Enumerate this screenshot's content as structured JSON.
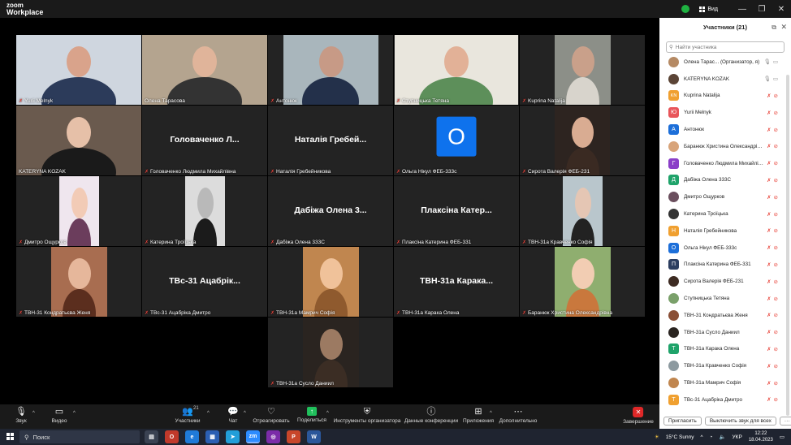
{
  "titlebar": {
    "logo_line1": "zoom",
    "logo_line2": "Workplace",
    "view_label": "Вид",
    "minimize": "—",
    "restore": "❐",
    "close": "✕",
    "colors": {
      "shield": "#1fb141"
    }
  },
  "tiles": [
    {
      "name": "Yurii Melnyk",
      "kind": "video",
      "muted": true,
      "colors": {
        "bg": "#cfd6df",
        "skin": "#d9a38b",
        "cloth": "#2c3b5a"
      }
    },
    {
      "name": "Олена Тарасова",
      "kind": "video",
      "muted": false,
      "colors": {
        "bg": "#b4a48f",
        "skin": "#e0b49a",
        "cloth": "#333333"
      }
    },
    {
      "name": "Антонюк",
      "kind": "video",
      "muted": true,
      "colors": {
        "bg": "#a9b6bc",
        "skin": "#c79a86",
        "cloth": "#23304a"
      }
    },
    {
      "name": "Ступницька Тетяна",
      "kind": "video",
      "muted": true,
      "colors": {
        "bg": "#e9e6dd",
        "skin": "#e2b197",
        "cloth": "#5d8f5a"
      }
    },
    {
      "name": "Kuprina Natalija",
      "kind": "video",
      "muted": true,
      "colors": {
        "bg": "#8c8f88",
        "skin": "#c9a08a",
        "cloth": "#d8d4cc"
      }
    },
    {
      "name": "KATERYNA KOZAK",
      "kind": "video",
      "muted": false,
      "active": true,
      "colors": {
        "bg": "#6a5a4e",
        "skin": "#e6c0a8",
        "cloth": "#1a1a1a"
      }
    },
    {
      "name": "Головаченко Людмила Михайлівна",
      "kind": "text",
      "display": "Головаченко Л...",
      "muted": true
    },
    {
      "name": "Наталія Гребейникова",
      "kind": "text",
      "display": "Наталія Гребей...",
      "muted": true
    },
    {
      "name": "Ольга Нікул ФЕБ-333с",
      "kind": "avatar",
      "letter": "О",
      "muted": true,
      "colors": {
        "avatar": "#0e72ed"
      }
    },
    {
      "name": "Сирота Валерія ФЕБ-231",
      "kind": "video",
      "muted": true,
      "colors": {
        "bg": "#2d2420",
        "skin": "#d9ac92",
        "cloth": "#3a2a22"
      }
    },
    {
      "name": "Дмитро Ощурков",
      "kind": "video",
      "muted": true,
      "colors": {
        "bg": "#efe6ee",
        "skin": "#f2cbb6",
        "cloth": "#6b3d5c"
      }
    },
    {
      "name": "Катерина Троїцька",
      "kind": "video",
      "muted": true,
      "colors": {
        "bg": "#dcdcdc",
        "skin": "#b9b9b9",
        "cloth": "#1b1b1b"
      }
    },
    {
      "name": "Дабіжа Олена 333С",
      "kind": "text",
      "display": "Дабіжа Олена 3...",
      "muted": true
    },
    {
      "name": "Плаксіна Катерина ФЕБ-331",
      "kind": "text",
      "display": "Плаксіна Катер...",
      "muted": true
    },
    {
      "name": "ТВН-31а Кравченко Софія",
      "kind": "video",
      "muted": true,
      "colors": {
        "bg": "#b9c6cc",
        "skin": "#e5c6b4",
        "cloth": "#222222"
      }
    },
    {
      "name": "ТВН-31 Кондратьєва Женя",
      "kind": "video",
      "muted": true,
      "colors": {
        "bg": "#a86d50",
        "skin": "#e6b79b",
        "cloth": "#5b2e1e"
      }
    },
    {
      "name": "ТВс-31 Ацабріка Дмитро",
      "kind": "text",
      "display": "ТВс-31 Ацабрік...",
      "muted": true
    },
    {
      "name": "ТВН-31а Мамрич Софія",
      "kind": "video",
      "muted": true,
      "colors": {
        "bg": "#c0864f",
        "skin": "#f0c29a",
        "cloth": "#8f5a2e"
      }
    },
    {
      "name": "ТВН-31а Карака Олена",
      "kind": "text",
      "display": "ТВН-31а Карака...",
      "muted": true
    },
    {
      "name": "Баранюк Христина Олександрівна",
      "kind": "video",
      "muted": true,
      "colors": {
        "bg": "#8fae6f",
        "skin": "#f2cdb3",
        "cloth": "#c9783d"
      }
    },
    {
      "name": "ТВН-31а Сусло Даниил",
      "kind": "video",
      "muted": true,
      "colors": {
        "bg": "#2a2420",
        "skin": "#9c7a62",
        "cloth": "#3b2d24"
      }
    }
  ],
  "toolbar": {
    "audio": "Звук",
    "video": "Видео",
    "participants": "Участники",
    "participants_count": "21",
    "chat": "Чат",
    "react": "Отреагировать",
    "share": "Поделиться",
    "host_tools": "Инструменты организатора",
    "conf_data": "Данные конференции",
    "apps": "Приложения",
    "more": "Дополнительно",
    "end": "Завершение",
    "colors": {
      "share": "#20c05c",
      "end": "#e02828"
    }
  },
  "panel": {
    "title": "Участники (21)",
    "search_placeholder": "Найти участника",
    "invite": "Пригласить",
    "mute_all": "Выключить звук для всех",
    "more": "···",
    "participants": [
      {
        "name": "Олена Тарас... (Организатор, я)",
        "avatar": "photo",
        "color": "#b58a64",
        "mic_on": true
      },
      {
        "name": "KATERYNA KOZAK",
        "avatar": "photo",
        "color": "#5b4436",
        "mic_on": true
      },
      {
        "name": "Kuprina Natalija",
        "avatar": "KN",
        "color": "#f0a030",
        "mic_on": false
      },
      {
        "name": "Yurii Melnyk",
        "avatar": "Ю",
        "color": "#e8555a",
        "mic_on": false
      },
      {
        "name": "Антонюк",
        "avatar": "А",
        "color": "#1d6fd9",
        "mic_on": false
      },
      {
        "name": "Баранюк Христина Олександрівна",
        "avatar": "photo",
        "color": "#d8a47a",
        "mic_on": false
      },
      {
        "name": "Головаченко Людмила Михайлівна",
        "avatar": "Г",
        "color": "#8a3fc8",
        "mic_on": false
      },
      {
        "name": "Дабіжа Олена 333С",
        "avatar": "Д",
        "color": "#1fa36a",
        "mic_on": false
      },
      {
        "name": "Дмитро Ощурков",
        "avatar": "photo",
        "color": "#6b4f5e",
        "mic_on": false
      },
      {
        "name": "Катерина Троїцька",
        "avatar": "photo",
        "color": "#333333",
        "mic_on": false
      },
      {
        "name": "Наталія Гребейникова",
        "avatar": "Н",
        "color": "#f0a030",
        "mic_on": false
      },
      {
        "name": "Ольга Нікул ФЕБ-333с",
        "avatar": "О",
        "color": "#1d6fd9",
        "mic_on": false
      },
      {
        "name": "Плаксіна Катерина ФЕБ-331",
        "avatar": "П",
        "color": "#2c3e60",
        "mic_on": false
      },
      {
        "name": "Сирота Валерія ФЕБ-231",
        "avatar": "photo",
        "color": "#3d2b22",
        "mic_on": false
      },
      {
        "name": "Ступницька Тетяна",
        "avatar": "photo",
        "color": "#7aa06a",
        "mic_on": false
      },
      {
        "name": "ТВН-31 Кондратьєва Женя",
        "avatar": "photo",
        "color": "#8a4f36",
        "mic_on": false
      },
      {
        "name": "ТВН-31а Сусло Даниил",
        "avatar": "photo",
        "color": "#2a2420",
        "mic_on": false
      },
      {
        "name": "ТВН-31а Карака Олена",
        "avatar": "Т",
        "color": "#1fa36a",
        "mic_on": false
      },
      {
        "name": "ТВН-31а Кравченко Софія",
        "avatar": "photo",
        "color": "#8d9aa0",
        "mic_on": false
      },
      {
        "name": "ТВН-31а Мамрич Софія",
        "avatar": "photo",
        "color": "#c0864f",
        "mic_on": false
      },
      {
        "name": "ТВс-31 Ацабріка Дмитро",
        "avatar": "Т",
        "color": "#f0a030",
        "mic_on": false
      }
    ]
  },
  "taskbar": {
    "search": "Поиск",
    "weather": "15°C Sunny",
    "lang": "УКР",
    "time": "12:22",
    "date": "18.04.2023"
  }
}
